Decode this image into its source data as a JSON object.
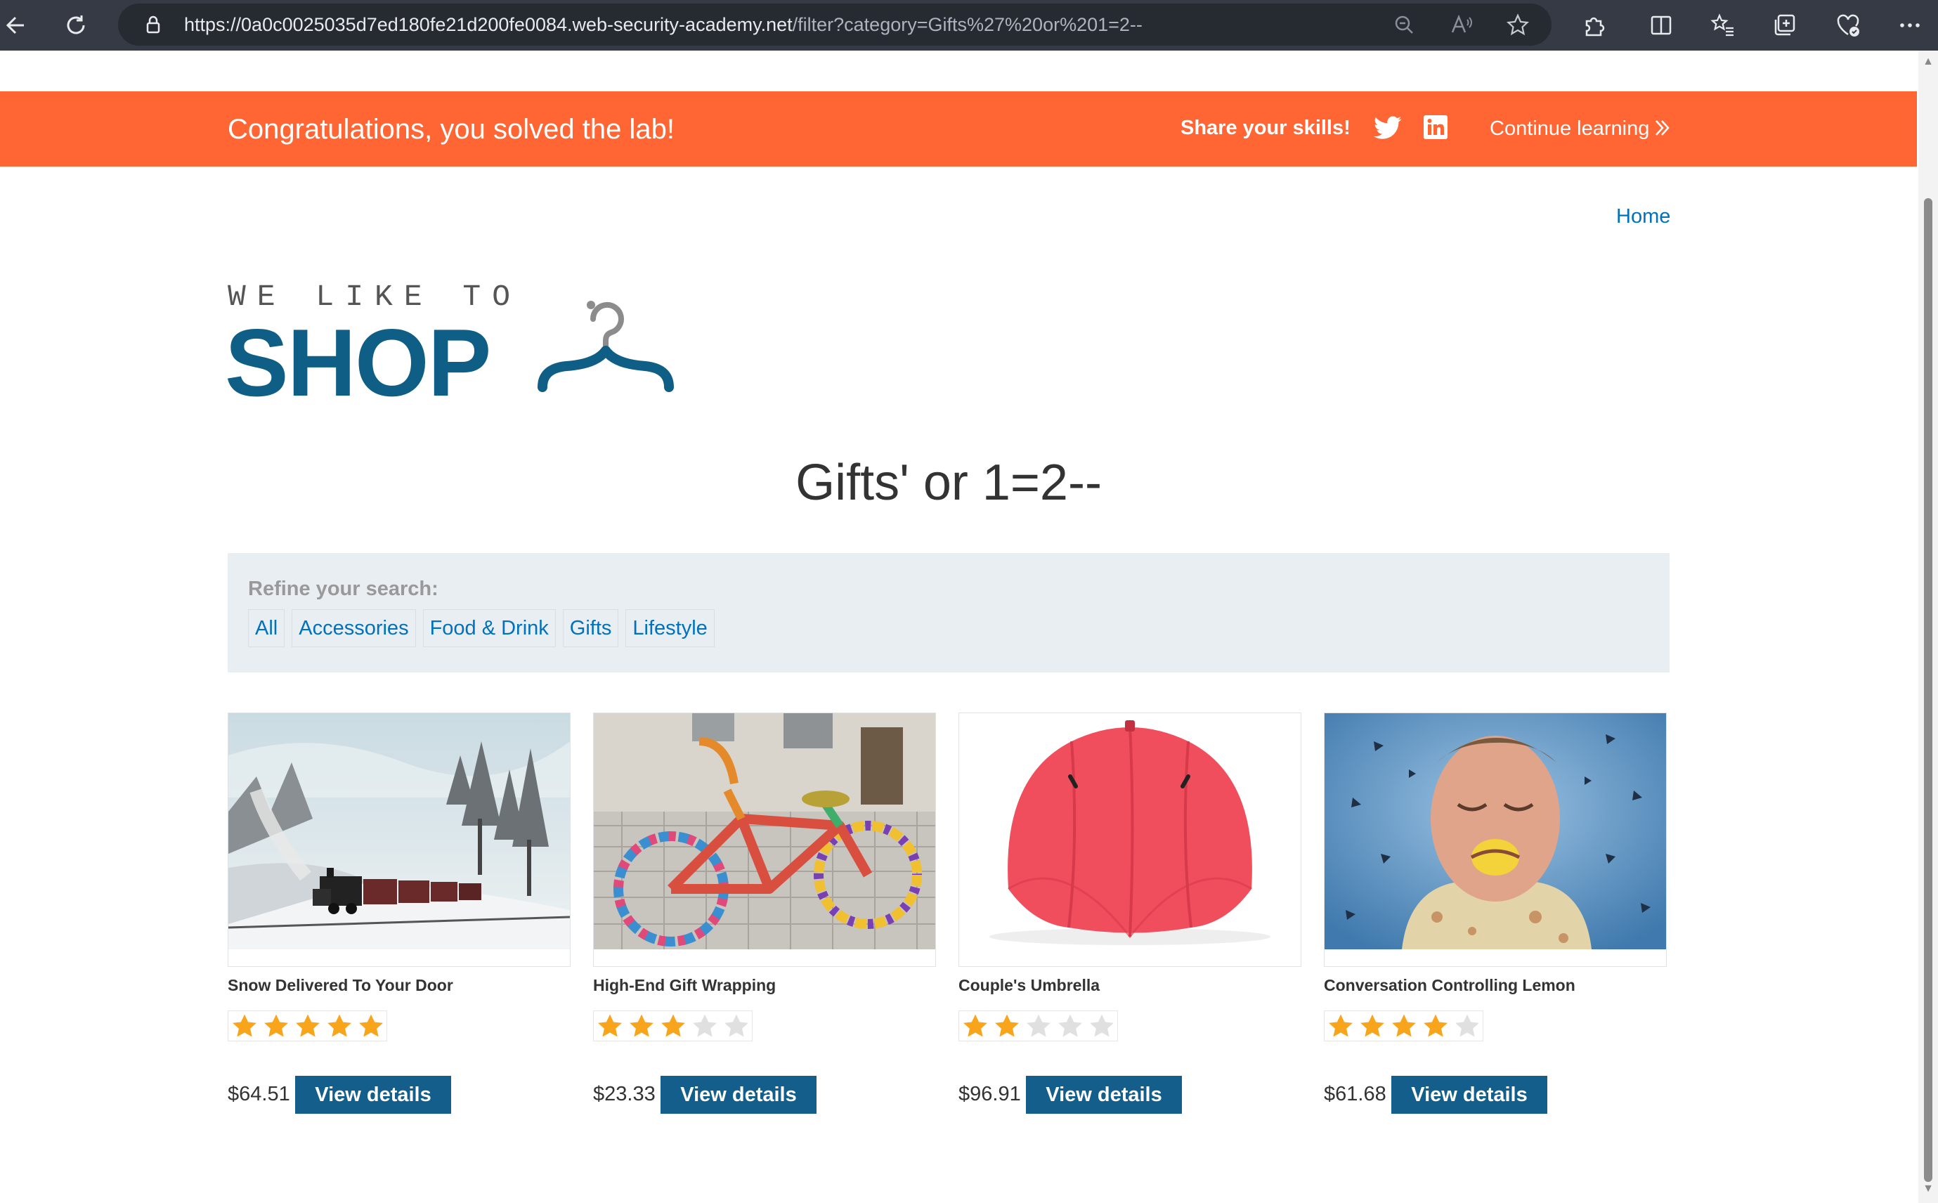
{
  "browser": {
    "url_host": "https://0a0c0025035d7ed180fe21d200fe0084.web-security-academy.net",
    "url_path": "/filter?category=Gifts%27%20or%201=2--",
    "icons": [
      "back-icon",
      "refresh-icon",
      "lock-icon",
      "zoom-icon",
      "read-aloud-icon",
      "favorite-star-icon",
      "extensions-icon",
      "split-screen-icon",
      "favorites-icon",
      "collections-icon",
      "browser-essentials-icon",
      "more-icon"
    ]
  },
  "banner": {
    "message": "Congratulations, you solved the lab!",
    "share_label": "Share your skills!",
    "continue_label": "Continue learning",
    "color": "#ff6633"
  },
  "header": {
    "home_link": "Home",
    "logo_top": "WE LIKE TO",
    "logo_main": "SHOP"
  },
  "page": {
    "heading": "Gifts' or 1=2--"
  },
  "filter": {
    "title": "Refine your search:",
    "categories": [
      "All",
      "Accessories",
      "Food & Drink",
      "Gifts",
      "Lifestyle"
    ]
  },
  "products": [
    {
      "name": "Snow Delivered To Your Door",
      "rating": 5,
      "price": "$64.51",
      "button": "View details"
    },
    {
      "name": "High-End Gift Wrapping",
      "rating": 3,
      "price": "$23.33",
      "button": "View details"
    },
    {
      "name": "Couple's Umbrella",
      "rating": 2,
      "price": "$96.91",
      "button": "View details"
    },
    {
      "name": "Conversation Controlling Lemon",
      "rating": 4,
      "price": "$61.68",
      "button": "View details"
    }
  ],
  "colors": {
    "brand": "#0f5e85",
    "link": "#0071bc",
    "button": "#135e8a",
    "star_on": "#f8a51c",
    "star_off": "#e0e0e0"
  }
}
